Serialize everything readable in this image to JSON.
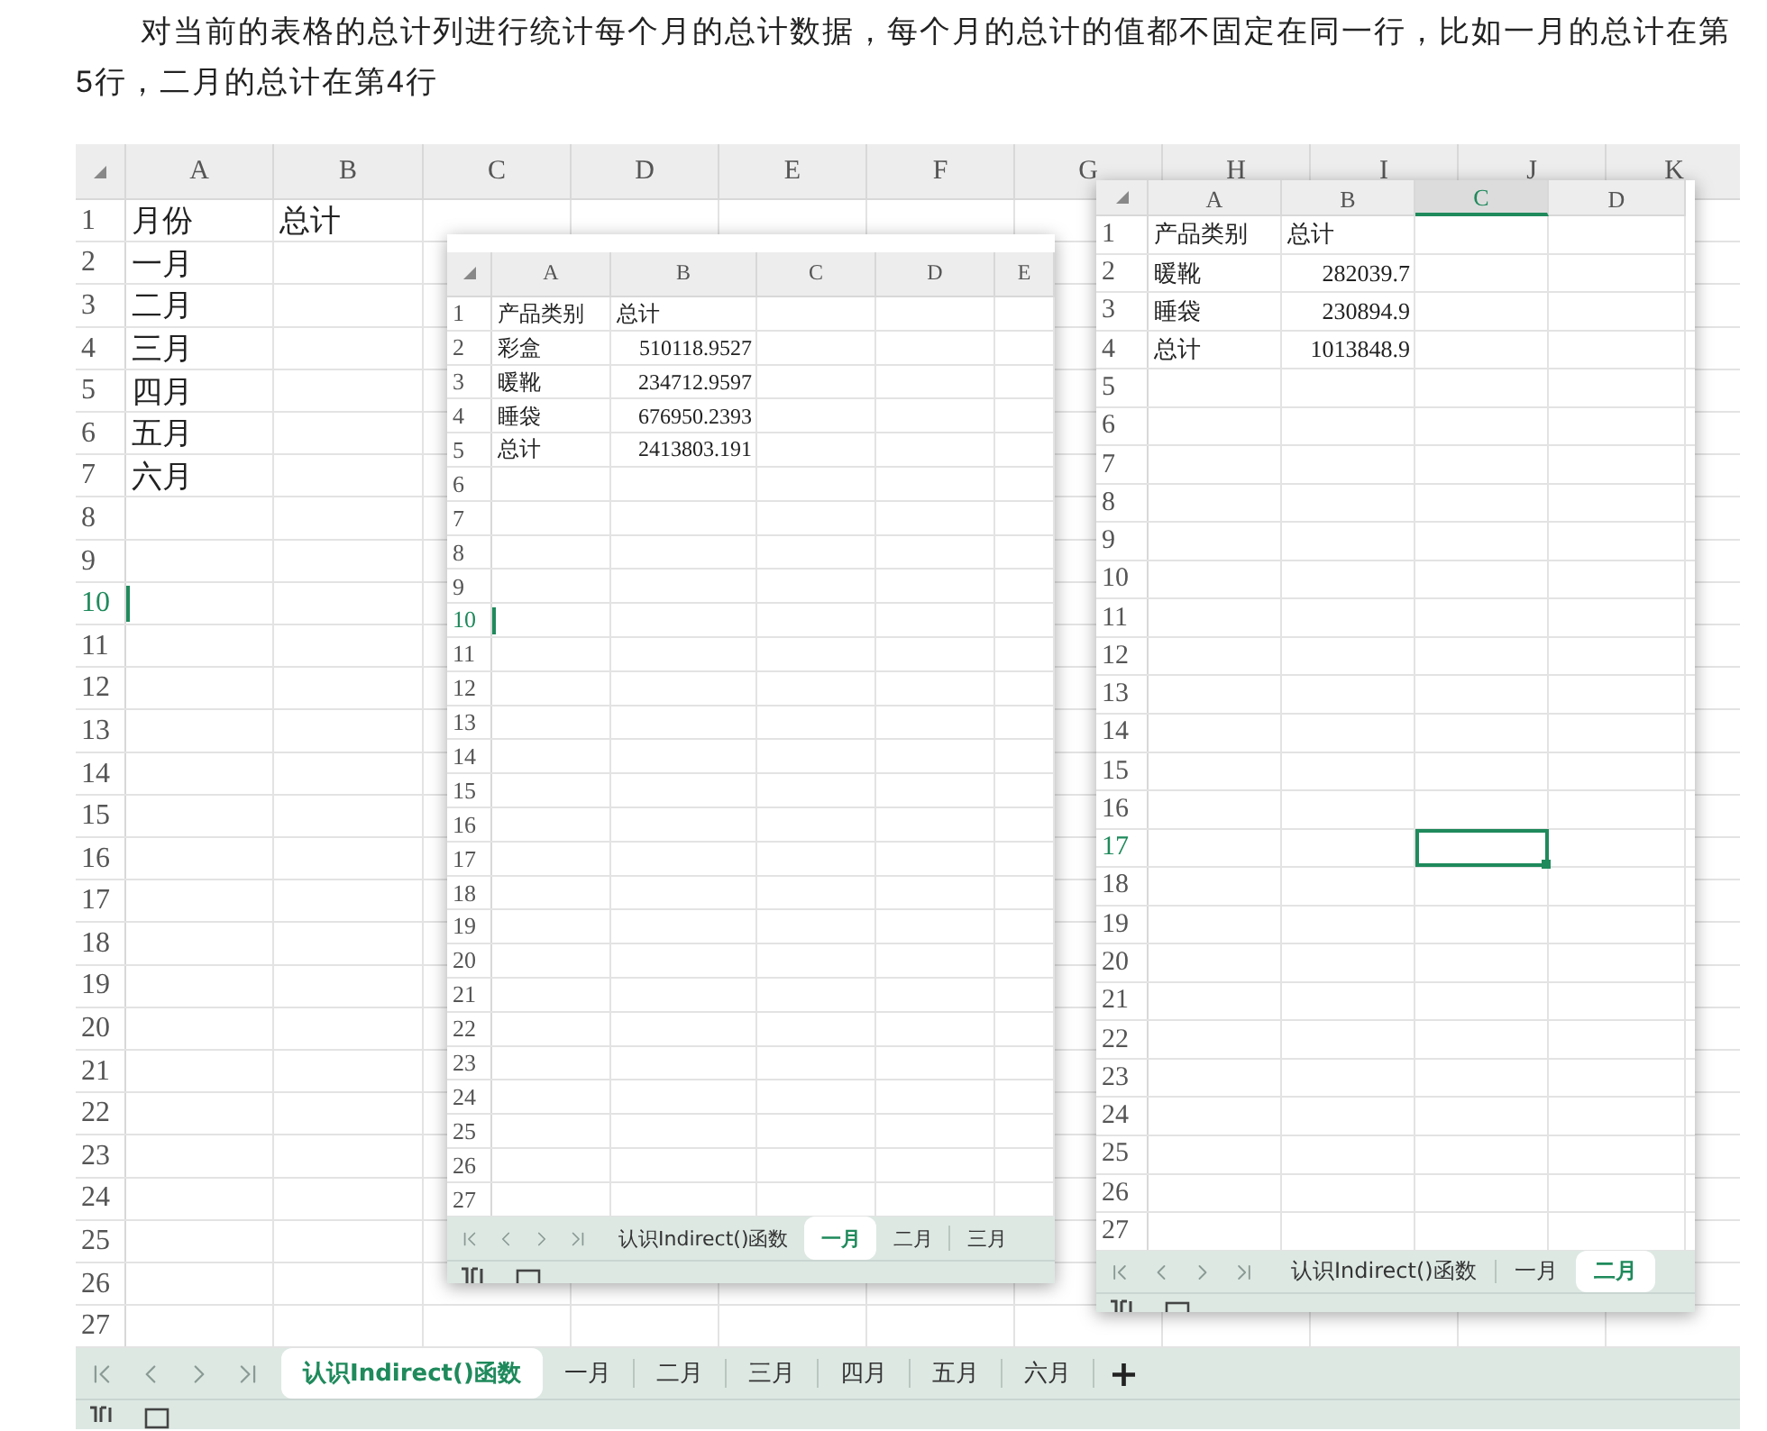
{
  "intro": "对当前的表格的总计列进行统计每个月的总计数据，每个月的总计的值都不固定在同一行，比如一月的总计在第5行，二月的总计在第4行",
  "sheet": {
    "columns": [
      {
        "label": "A",
        "selected": false
      },
      {
        "label": "B",
        "selected": false
      },
      {
        "label": "C",
        "selected": false
      },
      {
        "label": "D",
        "selected": false
      },
      {
        "label": "E",
        "selected": false
      },
      {
        "label": "F",
        "selected": false
      },
      {
        "label": "G",
        "selected": false
      },
      {
        "label": "H",
        "selected": false
      },
      {
        "label": "I",
        "selected": false
      },
      {
        "label": "J",
        "selected": false
      },
      {
        "label": "K",
        "selected": false
      }
    ],
    "rows": [
      {
        "n": "1",
        "selected": false,
        "cells": [
          {
            "text": "月份",
            "kind": "text"
          },
          {
            "text": "总计",
            "kind": "text"
          }
        ]
      },
      {
        "n": "2",
        "selected": false,
        "cells": [
          {
            "text": "一月",
            "kind": "text"
          }
        ]
      },
      {
        "n": "3",
        "selected": false,
        "cells": [
          {
            "text": "二月",
            "kind": "text"
          }
        ]
      },
      {
        "n": "4",
        "selected": false,
        "cells": [
          {
            "text": "三月",
            "kind": "text"
          }
        ]
      },
      {
        "n": "5",
        "selected": false,
        "cells": [
          {
            "text": "四月",
            "kind": "text"
          }
        ]
      },
      {
        "n": "6",
        "selected": false,
        "cells": [
          {
            "text": "五月",
            "kind": "text"
          }
        ]
      },
      {
        "n": "7",
        "selected": false,
        "cells": [
          {
            "text": "六月",
            "kind": "text"
          }
        ]
      },
      {
        "n": "8",
        "selected": false
      },
      {
        "n": "9",
        "selected": false
      },
      {
        "n": "10",
        "selected": true
      },
      {
        "n": "11",
        "selected": false
      },
      {
        "n": "12",
        "selected": false
      },
      {
        "n": "13",
        "selected": false
      },
      {
        "n": "14",
        "selected": false
      },
      {
        "n": "15",
        "selected": false
      },
      {
        "n": "16",
        "selected": false
      },
      {
        "n": "17",
        "selected": false
      },
      {
        "n": "18",
        "selected": false
      },
      {
        "n": "19",
        "selected": false
      },
      {
        "n": "20",
        "selected": false
      },
      {
        "n": "21",
        "selected": false
      },
      {
        "n": "22",
        "selected": false
      },
      {
        "n": "23",
        "selected": false
      },
      {
        "n": "24",
        "selected": false
      },
      {
        "n": "25",
        "selected": false
      },
      {
        "n": "26",
        "selected": false
      },
      {
        "n": "27",
        "selected": false
      }
    ],
    "tabs": [
      {
        "label": "认识Indirect()函数",
        "selected": true
      },
      {
        "label": "一月",
        "selected": false
      },
      {
        "label": "二月",
        "selected": false
      },
      {
        "label": "三月",
        "selected": false
      },
      {
        "label": "四月",
        "selected": false
      },
      {
        "label": "五月",
        "selected": false
      },
      {
        "label": "六月",
        "selected": false
      }
    ],
    "add_tab": "+"
  },
  "windows": [
    {
      "columns": [
        {
          "label": "A",
          "selected": false
        },
        {
          "label": "B",
          "selected": false
        },
        {
          "label": "C",
          "selected": false
        },
        {
          "label": "D",
          "selected": false
        },
        {
          "label": "E",
          "selected": false
        }
      ],
      "rows": [
        {
          "n": "1",
          "selected": false,
          "cells": [
            {
              "text": "产品类别",
              "kind": "text"
            },
            {
              "text": "总计",
              "kind": "text"
            }
          ]
        },
        {
          "n": "2",
          "selected": false,
          "cells": [
            {
              "text": "彩盒",
              "kind": "text"
            },
            {
              "text": "510118.9527",
              "kind": "number"
            }
          ]
        },
        {
          "n": "3",
          "selected": false,
          "cells": [
            {
              "text": "暖靴",
              "kind": "text"
            },
            {
              "text": "234712.9597",
              "kind": "number"
            }
          ]
        },
        {
          "n": "4",
          "selected": false,
          "cells": [
            {
              "text": "睡袋",
              "kind": "text"
            },
            {
              "text": "676950.2393",
              "kind": "number"
            }
          ]
        },
        {
          "n": "5",
          "selected": false,
          "cells": [
            {
              "text": "总计",
              "kind": "text"
            },
            {
              "text": "2413803.191",
              "kind": "number"
            }
          ]
        },
        {
          "n": "6",
          "selected": false
        },
        {
          "n": "7",
          "selected": false
        },
        {
          "n": "8",
          "selected": false
        },
        {
          "n": "9",
          "selected": false
        },
        {
          "n": "10",
          "selected": true
        },
        {
          "n": "11",
          "selected": false
        },
        {
          "n": "12",
          "selected": false
        },
        {
          "n": "13",
          "selected": false
        },
        {
          "n": "14",
          "selected": false
        },
        {
          "n": "15",
          "selected": false
        },
        {
          "n": "16",
          "selected": false
        },
        {
          "n": "17",
          "selected": false
        },
        {
          "n": "18",
          "selected": false
        },
        {
          "n": "19",
          "selected": false
        },
        {
          "n": "20",
          "selected": false
        },
        {
          "n": "21",
          "selected": false
        },
        {
          "n": "22",
          "selected": false
        },
        {
          "n": "23",
          "selected": false
        },
        {
          "n": "24",
          "selected": false
        },
        {
          "n": "25",
          "selected": false
        },
        {
          "n": "26",
          "selected": false
        },
        {
          "n": "27",
          "selected": false
        }
      ],
      "tabs": [
        {
          "label": "认识Indirect()函数",
          "selected": false
        },
        {
          "label": "一月",
          "selected": true
        },
        {
          "label": "二月",
          "selected": false
        },
        {
          "label": "三月",
          "selected": false
        }
      ]
    },
    {
      "columns": [
        {
          "label": "A",
          "selected": false
        },
        {
          "label": "B",
          "selected": false
        },
        {
          "label": "C",
          "selected": true
        },
        {
          "label": "D",
          "selected": false
        }
      ],
      "rows": [
        {
          "n": "1",
          "selected": false,
          "cells": [
            {
              "text": "产品类别",
              "kind": "text"
            },
            {
              "text": "总计",
              "kind": "text"
            }
          ]
        },
        {
          "n": "2",
          "selected": false,
          "cells": [
            {
              "text": "暖靴",
              "kind": "text"
            },
            {
              "text": "282039.7",
              "kind": "number"
            }
          ]
        },
        {
          "n": "3",
          "selected": false,
          "cells": [
            {
              "text": "睡袋",
              "kind": "text"
            },
            {
              "text": "230894.9",
              "kind": "number"
            }
          ]
        },
        {
          "n": "4",
          "selected": false,
          "cells": [
            {
              "text": "总计",
              "kind": "text"
            },
            {
              "text": "1013848.9",
              "kind": "number"
            }
          ]
        },
        {
          "n": "5",
          "selected": false
        },
        {
          "n": "6",
          "selected": false
        },
        {
          "n": "7",
          "selected": false
        },
        {
          "n": "8",
          "selected": false
        },
        {
          "n": "9",
          "selected": false
        },
        {
          "n": "10",
          "selected": false
        },
        {
          "n": "11",
          "selected": false
        },
        {
          "n": "12",
          "selected": false
        },
        {
          "n": "13",
          "selected": false
        },
        {
          "n": "14",
          "selected": false
        },
        {
          "n": "15",
          "selected": false
        },
        {
          "n": "16",
          "selected": false
        },
        {
          "n": "17",
          "selected": true
        },
        {
          "n": "18",
          "selected": false
        },
        {
          "n": "19",
          "selected": false
        },
        {
          "n": "20",
          "selected": false
        },
        {
          "n": "21",
          "selected": false
        },
        {
          "n": "22",
          "selected": false
        },
        {
          "n": "23",
          "selected": false
        },
        {
          "n": "24",
          "selected": false
        },
        {
          "n": "25",
          "selected": false
        },
        {
          "n": "26",
          "selected": false
        },
        {
          "n": "27",
          "selected": false
        }
      ],
      "tabs": [
        {
          "label": "认识Indirect()函数",
          "selected": false
        },
        {
          "label": "一月",
          "selected": false
        },
        {
          "label": "二月",
          "selected": true
        }
      ]
    }
  ]
}
